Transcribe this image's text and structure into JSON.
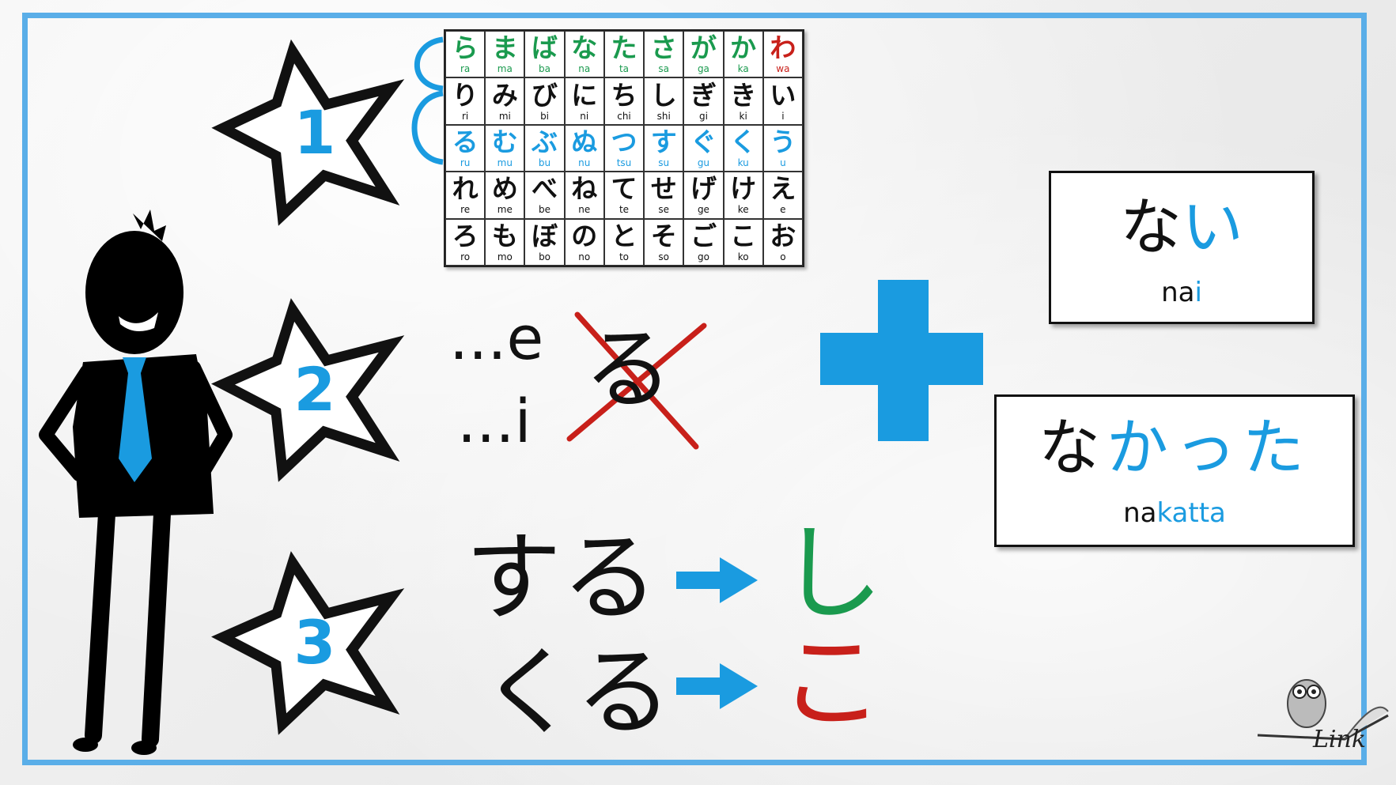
{
  "kana_chart": {
    "rows": [
      [
        {
          "k": "ら",
          "r": "ra",
          "c": "#1a9a4e"
        },
        {
          "k": "ま",
          "r": "ma",
          "c": "#1a9a4e"
        },
        {
          "k": "ば",
          "r": "ba",
          "c": "#1a9a4e"
        },
        {
          "k": "な",
          "r": "na",
          "c": "#1a9a4e"
        },
        {
          "k": "た",
          "r": "ta",
          "c": "#1a9a4e"
        },
        {
          "k": "さ",
          "r": "sa",
          "c": "#1a9a4e"
        },
        {
          "k": "が",
          "r": "ga",
          "c": "#1a9a4e"
        },
        {
          "k": "か",
          "r": "ka",
          "c": "#1a9a4e"
        },
        {
          "k": "わ",
          "r": "wa",
          "c": "#c8201a"
        }
      ],
      [
        {
          "k": "り",
          "r": "ri",
          "c": "#111"
        },
        {
          "k": "み",
          "r": "mi",
          "c": "#111"
        },
        {
          "k": "び",
          "r": "bi",
          "c": "#111"
        },
        {
          "k": "に",
          "r": "ni",
          "c": "#111"
        },
        {
          "k": "ち",
          "r": "chi",
          "c": "#111"
        },
        {
          "k": "し",
          "r": "shi",
          "c": "#111"
        },
        {
          "k": "ぎ",
          "r": "gi",
          "c": "#111"
        },
        {
          "k": "き",
          "r": "ki",
          "c": "#111"
        },
        {
          "k": "い",
          "r": "i",
          "c": "#111"
        }
      ],
      [
        {
          "k": "る",
          "r": "ru",
          "c": "#1a9be0"
        },
        {
          "k": "む",
          "r": "mu",
          "c": "#1a9be0"
        },
        {
          "k": "ぶ",
          "r": "bu",
          "c": "#1a9be0"
        },
        {
          "k": "ぬ",
          "r": "nu",
          "c": "#1a9be0"
        },
        {
          "k": "つ",
          "r": "tsu",
          "c": "#1a9be0"
        },
        {
          "k": "す",
          "r": "su",
          "c": "#1a9be0"
        },
        {
          "k": "ぐ",
          "r": "gu",
          "c": "#1a9be0"
        },
        {
          "k": "く",
          "r": "ku",
          "c": "#1a9be0"
        },
        {
          "k": "う",
          "r": "u",
          "c": "#1a9be0"
        }
      ],
      [
        {
          "k": "れ",
          "r": "re",
          "c": "#111"
        },
        {
          "k": "め",
          "r": "me",
          "c": "#111"
        },
        {
          "k": "べ",
          "r": "be",
          "c": "#111"
        },
        {
          "k": "ね",
          "r": "ne",
          "c": "#111"
        },
        {
          "k": "て",
          "r": "te",
          "c": "#111"
        },
        {
          "k": "せ",
          "r": "se",
          "c": "#111"
        },
        {
          "k": "げ",
          "r": "ge",
          "c": "#111"
        },
        {
          "k": "け",
          "r": "ke",
          "c": "#111"
        },
        {
          "k": "え",
          "r": "e",
          "c": "#111"
        }
      ],
      [
        {
          "k": "ろ",
          "r": "ro",
          "c": "#111"
        },
        {
          "k": "も",
          "r": "mo",
          "c": "#111"
        },
        {
          "k": "ぼ",
          "r": "bo",
          "c": "#111"
        },
        {
          "k": "の",
          "r": "no",
          "c": "#111"
        },
        {
          "k": "と",
          "r": "to",
          "c": "#111"
        },
        {
          "k": "そ",
          "r": "so",
          "c": "#111"
        },
        {
          "k": "ご",
          "r": "go",
          "c": "#111"
        },
        {
          "k": "こ",
          "r": "ko",
          "c": "#111"
        },
        {
          "k": "お",
          "r": "o",
          "c": "#111"
        }
      ]
    ]
  },
  "steps": {
    "one": "1",
    "two": "2",
    "three": "3"
  },
  "step2": {
    "suffix_e": "...e",
    "suffix_i": "...i",
    "crossed": "る"
  },
  "step3": {
    "suru": "する",
    "shi": "し",
    "kuru": "くる",
    "ko": "こ"
  },
  "box_nai": {
    "kana_black": "な",
    "kana_blue": "い",
    "rom_black": "na",
    "rom_blue": "i"
  },
  "box_nakatta": {
    "kana_black": "な",
    "kana_blue": "かった",
    "rom_black": "na",
    "rom_blue": "katta"
  },
  "logo": {
    "text": "Link"
  },
  "colors": {
    "accent_blue": "#1a9be0",
    "green": "#1a9a4e",
    "red": "#c8201a",
    "frame": "#5aaee8"
  }
}
